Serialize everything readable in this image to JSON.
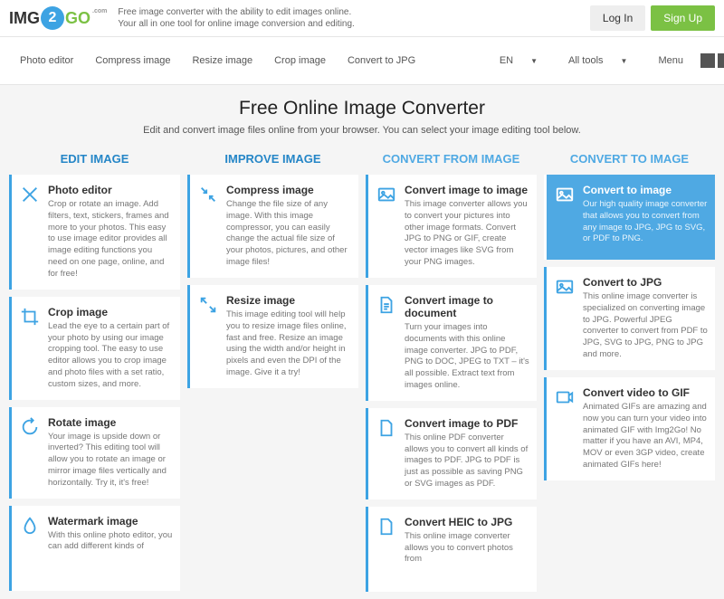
{
  "header": {
    "logo_img": "IMG",
    "logo_two": "2",
    "logo_go": "GO",
    "logo_sub": ".com",
    "tagline1": "Free image converter with the ability to edit images online.",
    "tagline2": "Your all in one tool for online image conversion and editing.",
    "login": "Log In",
    "signup": "Sign Up"
  },
  "subnav": {
    "items": [
      "Photo editor",
      "Compress image",
      "Resize image",
      "Crop image",
      "Convert to JPG"
    ],
    "lang": "EN",
    "alltools": "All tools",
    "menu": "Menu"
  },
  "hero": {
    "title": "Free Online Image Converter",
    "subtitle": "Edit and convert image files online from your browser. You can select your image editing tool below."
  },
  "cols": [
    {
      "head": "EDIT IMAGE",
      "cards": [
        {
          "title": "Photo editor",
          "desc": "Crop or rotate an image. Add filters, text, stickers, frames and more to your photos. This easy to use image editor provides all image editing functions you need on one page, online, and for free!"
        },
        {
          "title": "Crop image",
          "desc": "Lead the eye to a certain part of your photo by using our image cropping tool. The easy to use editor allows you to crop image and photo files with a set ratio, custom sizes, and more."
        },
        {
          "title": "Rotate image",
          "desc": "Your image is upside down or inverted? This editing tool will allow you to rotate an image or mirror image files vertically and horizontally. Try it, it's free!"
        },
        {
          "title": "Watermark image",
          "desc": "With this online photo editor, you can add different kinds of"
        }
      ]
    },
    {
      "head": "IMPROVE IMAGE",
      "cards": [
        {
          "title": "Compress image",
          "desc": "Change the file size of any image. With this image compressor, you can easily change the actual file size of your photos, pictures, and other image files!"
        },
        {
          "title": "Resize image",
          "desc": "This image editing tool will help you to resize image files online, fast and free. Resize an image using the width and/or height in pixels and even the DPI of the image. Give it a try!"
        }
      ]
    },
    {
      "head": "CONVERT FROM IMAGE",
      "cards": [
        {
          "title": "Convert image to image",
          "desc": "This image converter allows you to convert your pictures into other image formats. Convert JPG to PNG or GIF, create vector images like SVG from your PNG images."
        },
        {
          "title": "Convert image to document",
          "desc": "Turn your images into documents with this online image converter. JPG to PDF, PNG to DOC, JPEG to TXT – it's all possible. Extract text from images online."
        },
        {
          "title": "Convert image to PDF",
          "desc": "This online PDF converter allows you to convert all kinds of images to PDF. JPG to PDF is just as possible as saving PNG or SVG images as PDF."
        },
        {
          "title": "Convert HEIC to JPG",
          "desc": "This online image converter allows you to convert photos from"
        }
      ]
    },
    {
      "head": "CONVERT TO IMAGE",
      "cards": [
        {
          "title": "Convert to image",
          "desc": "Our high quality image converter that allows you to convert from any image to JPG, JPG to SVG, or PDF to PNG.",
          "active": true
        },
        {
          "title": "Convert to JPG",
          "desc": "This online image converter is specialized on converting image to JPG. Powerful JPEG converter to convert from PDF to JPG, SVG to JPG, PNG to JPG and more."
        },
        {
          "title": "Convert video to GIF",
          "desc": "Animated GIFs are amazing and now you can turn your video into animated GIF with Img2Go! No matter if you have an AVI, MP4, MOV or even 3GP video, create animated GIFs here!"
        }
      ]
    }
  ]
}
